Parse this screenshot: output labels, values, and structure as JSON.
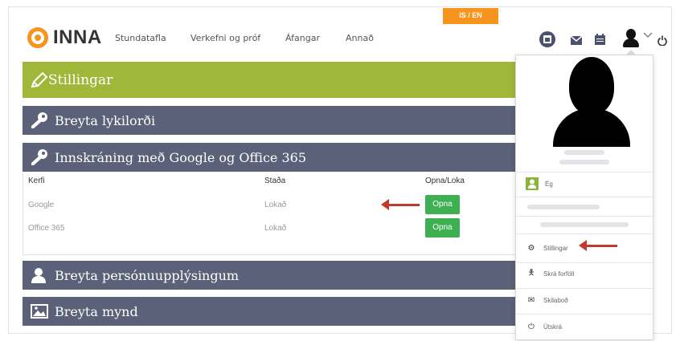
{
  "lang_toggle": "IS / EN",
  "logo": {
    "text": "INNA"
  },
  "nav": [
    "Stundatafla",
    "Verkefni og próf",
    "Áfangar",
    "Annað"
  ],
  "icons": {
    "profile_badge": "id-badge-icon",
    "mail": "envelope-icon",
    "calendar": "calendar-icon",
    "user": "user-icon",
    "chevron": "chevron-down-icon",
    "power": "power-icon"
  },
  "settings": {
    "title": "Stillingar"
  },
  "sections": {
    "password": "Breyta lykilorði",
    "google": "Innskráning með Google og Office 365",
    "personal": "Breyta persónuupplýsingum",
    "photo": "Breyta mynd"
  },
  "table": {
    "headers": [
      "Kerfi",
      "Staða",
      "Opna/Loka"
    ],
    "rows": [
      {
        "system": "Google",
        "status": "Lokað",
        "action": "Opna"
      },
      {
        "system": "Office 365",
        "status": "Lokað",
        "action": "Opna"
      }
    ]
  },
  "dropdown": {
    "me": "Ég",
    "settings": "Stillingar",
    "absence": "Skrá forföll",
    "messages": "Skilaboð",
    "logout": "Útskrá"
  },
  "colors": {
    "accent_orange": "#f7941d",
    "settings_green": "#a0b73a",
    "panel_slate": "#5a6178",
    "button_green": "#3fb052",
    "arrow_red": "#c0392b"
  }
}
